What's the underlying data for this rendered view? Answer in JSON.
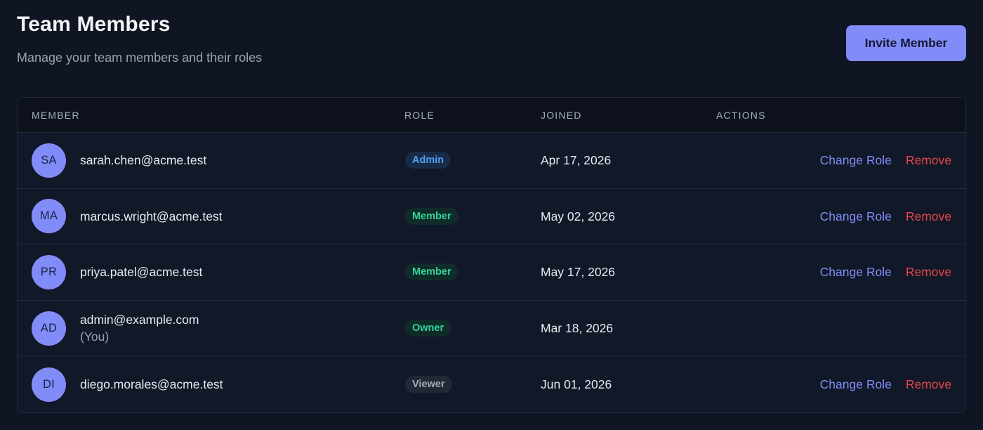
{
  "header": {
    "title": "Team Members",
    "subtitle": "Manage your team members and their roles",
    "invite_label": "Invite Member"
  },
  "table": {
    "columns": {
      "member": "MEMBER",
      "role": "ROLE",
      "joined": "JOINED",
      "actions": "ACTIONS"
    },
    "rows": [
      {
        "initials": "SA",
        "email": "sarah.chen@acme.test",
        "role": "Admin",
        "joined": "Apr 17, 2026",
        "change_role_label": "Change Role",
        "remove_label": "Remove"
      },
      {
        "initials": "MA",
        "email": "marcus.wright@acme.test",
        "role": "Member",
        "joined": "May 02, 2026",
        "change_role_label": "Change Role",
        "remove_label": "Remove"
      },
      {
        "initials": "PR",
        "email": "priya.patel@acme.test",
        "role": "Member",
        "joined": "May 17, 2026",
        "change_role_label": "Change Role",
        "remove_label": "Remove"
      },
      {
        "initials": "AD",
        "email": "admin@example.com",
        "you_label": "(You)",
        "role": "Owner",
        "joined": "Mar 18, 2026"
      },
      {
        "initials": "DI",
        "email": "diego.morales@acme.test",
        "role": "Viewer",
        "joined": "Jun 01, 2026",
        "change_role_label": "Change Role",
        "remove_label": "Remove"
      }
    ]
  },
  "colors": {
    "page_background": "#0f1522",
    "accent": "#818cf8",
    "danger": "#e5484d",
    "role_admin": "#4ea1f5",
    "role_member": "#34d399",
    "role_owner": "#34d399",
    "role_viewer": "#a3abba"
  }
}
